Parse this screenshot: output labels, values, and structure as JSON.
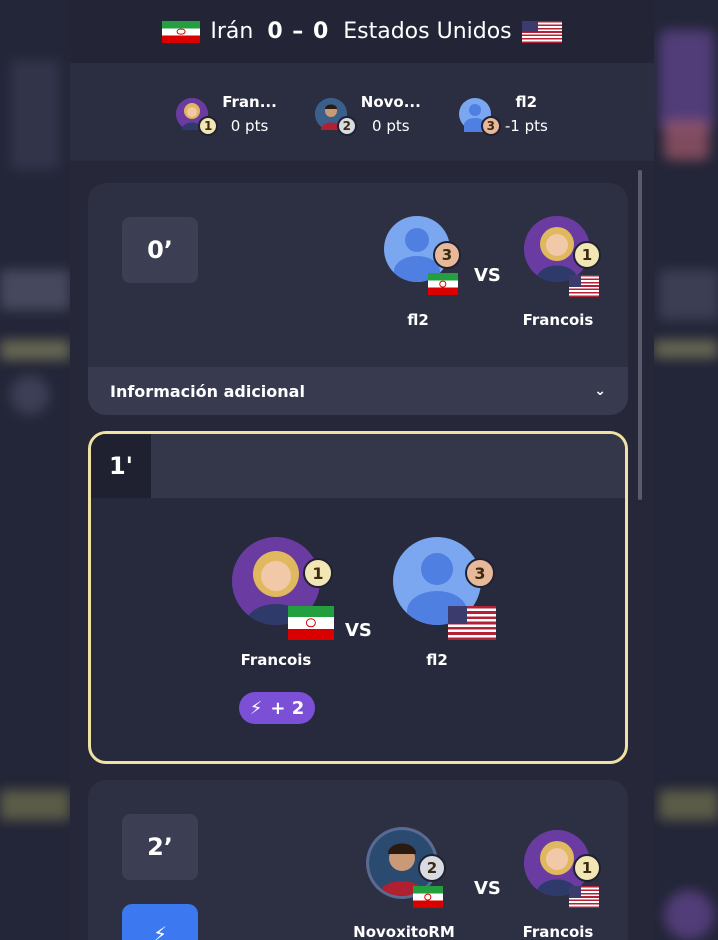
{
  "header": {
    "home_team": "Irán",
    "score": "0 – 0",
    "away_team": "Estados Unidos"
  },
  "leaderboard": [
    {
      "name": "Fran...",
      "points": "0 pts",
      "rank": "1"
    },
    {
      "name": "Novo...",
      "points": "0 pts",
      "rank": "2"
    },
    {
      "name": "fl2",
      "points": "-1 pts",
      "rank": "3"
    }
  ],
  "cards": [
    {
      "minute": "0’",
      "left_player": {
        "name": "fl2",
        "rank": "3",
        "flag": "iran-flag"
      },
      "vs": "VS",
      "right_player": {
        "name": "Francois",
        "rank": "1",
        "flag": "usa-flag"
      },
      "info_label": "Información adicional"
    },
    {
      "minute": "1'",
      "left_player": {
        "name": "Francois",
        "rank": "1",
        "flag": "iran-flag"
      },
      "vs": "VS",
      "right_player": {
        "name": "fl2",
        "rank": "3",
        "flag": "usa-flag"
      },
      "bonus": {
        "icon": "lightning-icon",
        "text": "+ 2"
      }
    },
    {
      "minute": "2’",
      "left_player": {
        "name": "NovoxitoRM",
        "rank": "2",
        "flag": "iran-flag"
      },
      "vs": "VS",
      "right_player": {
        "name": "Francois",
        "rank": "1",
        "flag": "usa-flag"
      },
      "button_icon": "lightning-icon"
    }
  ],
  "colors": {
    "accent_border": "#f0e2a0",
    "bonus_pill": "#7b4fd6",
    "action_button": "#3c78f0"
  }
}
